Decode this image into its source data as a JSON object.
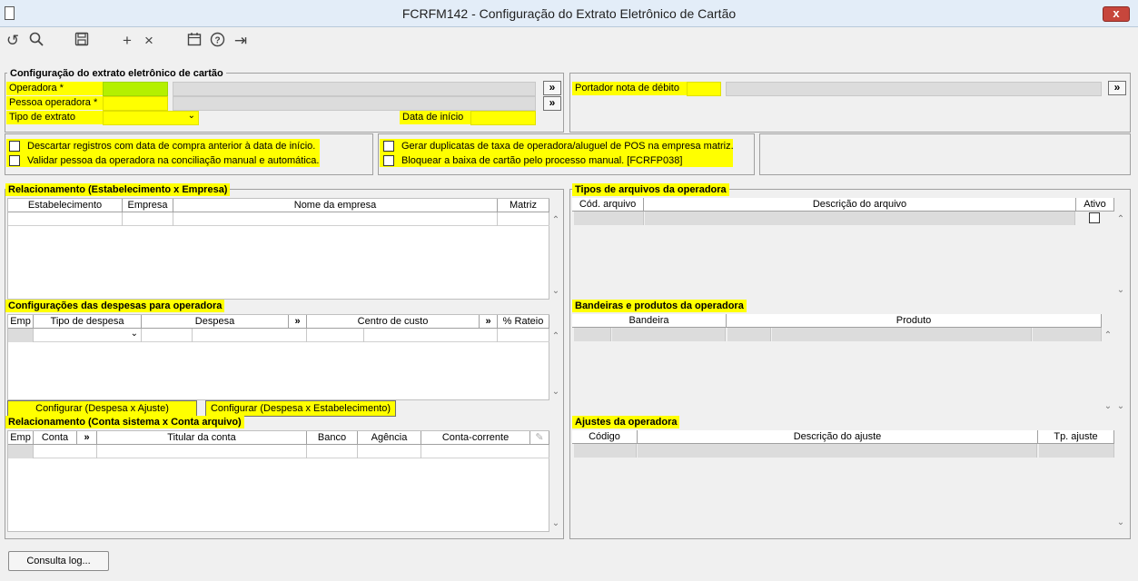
{
  "window": {
    "title": "FCRFM142 - Configuração do Extrato Eletrônico de Cartão",
    "close": "x"
  },
  "toolbar": {
    "refresh": "↺",
    "search": "🔍",
    "save": "💾",
    "add": "+",
    "delete": "×",
    "calendar": "📅",
    "help": "?",
    "exit": "⇥"
  },
  "config": {
    "legend": "Configuração do extrato eletrônico de cartão",
    "operadora": "Operadora *",
    "pessoa": "Pessoa operadora *",
    "tipo": "Tipo de extrato",
    "data_inicio": "Data de início",
    "portador": "Portador nota de débito",
    "more": "»"
  },
  "checks": {
    "descartar": "Descartar registros com data de compra anterior à data de início.",
    "validar": "Validar pessoa da operadora na conciliação manual e automática.",
    "gerar": "Gerar duplicatas de taxa de operadora/aluguel de POS na empresa matriz.",
    "bloquear": "Bloquear a baixa de cartão pelo processo manual. [FCRFP038]"
  },
  "rel_estab": {
    "legend": "Relacionamento (Estabelecimento x Empresa)",
    "cols": [
      "Estabelecimento",
      "Empresa",
      "Nome da empresa",
      "Matriz"
    ]
  },
  "tipos_arq": {
    "legend": "Tipos de arquivos da operadora",
    "cols": [
      "Cód. arquivo",
      "Descrição do arquivo",
      "Ativo"
    ]
  },
  "despesas": {
    "legend": "Configurações das despesas para operadora",
    "cols": [
      "Emp",
      "Tipo de despesa",
      "Despesa",
      "»",
      "Centro de custo",
      "»",
      "% Rateio"
    ],
    "btn1": "Configurar (Despesa x Ajuste)",
    "btn2": "Configurar (Despesa x Estabelecimento)"
  },
  "bandeiras": {
    "legend": "Bandeiras e produtos da operadora",
    "cols": [
      "Bandeira",
      "Produto"
    ]
  },
  "rel_conta": {
    "legend": "Relacionamento (Conta sistema x Conta arquivo)",
    "cols": [
      "Emp",
      "Conta",
      "»",
      "Titular da conta",
      "Banco",
      "Agência",
      "Conta-corrente"
    ]
  },
  "ajustes": {
    "legend": "Ajustes da operadora",
    "cols": [
      "Código",
      "Descrição do ajuste",
      "Tp. ajuste"
    ]
  },
  "footer": {
    "consulta": "Consulta log..."
  }
}
